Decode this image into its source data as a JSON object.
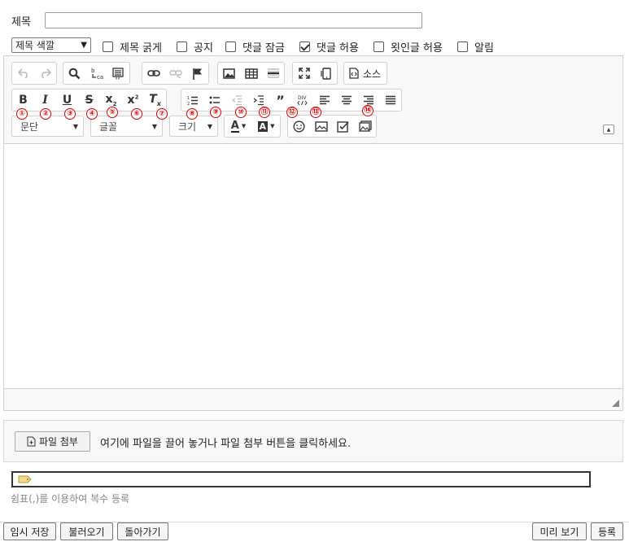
{
  "title_row": {
    "label": "제목",
    "value": ""
  },
  "options": {
    "title_color": "제목 색깔",
    "bold_title": {
      "label": "제목 굵게",
      "checked": false
    },
    "notice": {
      "label": "공지",
      "checked": false
    },
    "lock_comments": {
      "label": "댓글 잠금",
      "checked": false
    },
    "allow_comments": {
      "label": "댓글 허용",
      "checked": true
    },
    "allow_anon_comments": {
      "label": "욋인글 허용",
      "checked": false
    },
    "notify": {
      "label": "알림",
      "checked": false
    }
  },
  "toolbar": {
    "source_label": "소스",
    "paragraph": "문단",
    "font": "글꼴",
    "size": "크기",
    "annotations": [
      "①",
      "②",
      "③",
      "④",
      "⑤",
      "⑥",
      "⑦",
      "⑧",
      "⑨",
      "⑩",
      "⑪",
      "⑫",
      "⑬",
      "⑭"
    ],
    "annotation_color": "#e00000"
  },
  "attach": {
    "button": "파일 첨부",
    "hint": "여기에 파일을 끌어 놓거나 파일 첨부 버튼을 클릭하세요."
  },
  "tags": {
    "value": "",
    "hint": "쉼표(,)를 이용하여 복수 등록"
  },
  "buttons": {
    "temp_save": "임시 저장",
    "load": "불러오기",
    "back": "돌아가기",
    "preview": "미리 보기",
    "submit": "등록"
  }
}
